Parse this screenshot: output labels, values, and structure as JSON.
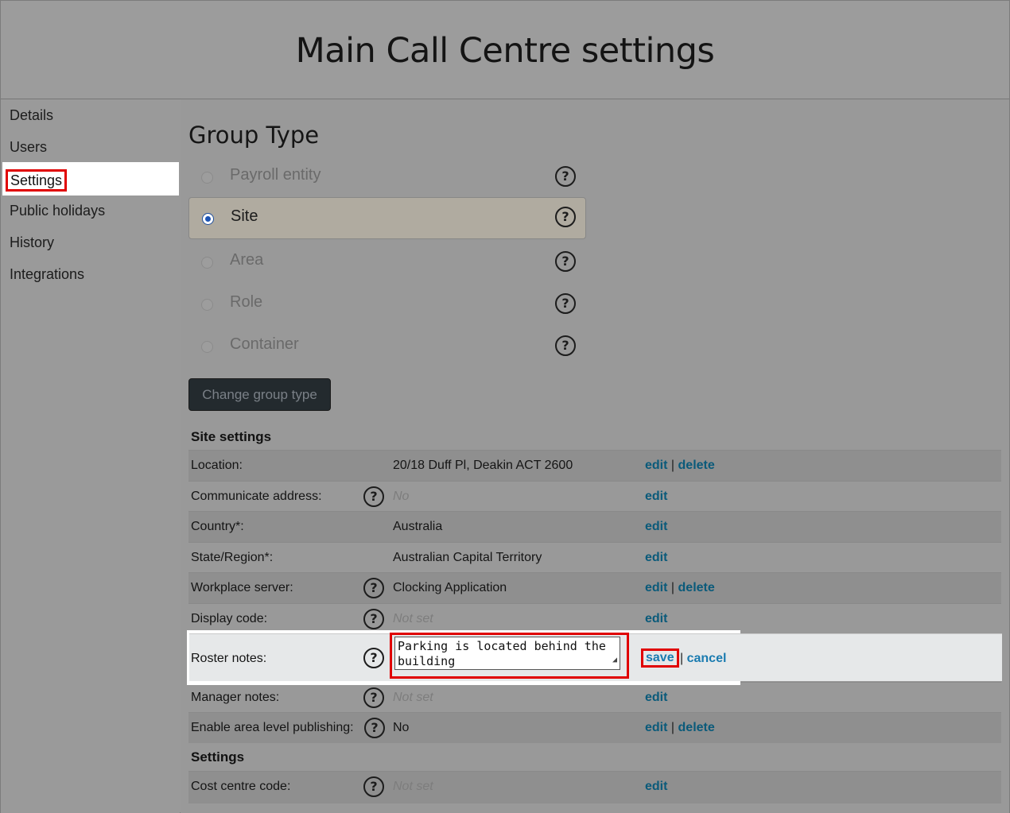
{
  "header": {
    "title": "Main Call Centre settings"
  },
  "sidebar": {
    "items": [
      {
        "label": "Details"
      },
      {
        "label": "Users"
      },
      {
        "label": "Settings"
      },
      {
        "label": "Public holidays"
      },
      {
        "label": "History"
      },
      {
        "label": "Integrations"
      }
    ],
    "active": "Settings"
  },
  "group_type": {
    "title": "Group Type",
    "options": [
      {
        "label": "Payroll entity",
        "selected": false
      },
      {
        "label": "Site",
        "selected": true
      },
      {
        "label": "Area",
        "selected": false
      },
      {
        "label": "Role",
        "selected": false
      },
      {
        "label": "Container",
        "selected": false
      }
    ],
    "change_button": "Change group type"
  },
  "site_settings": {
    "title": "Site settings",
    "rows": [
      {
        "name": "Location:",
        "value": "20/18 Duff Pl, Deakin ACT 2600",
        "edit": "edit",
        "delete": "delete"
      },
      {
        "name": "Communicate address:",
        "value": "No",
        "edit": "edit"
      },
      {
        "name": "Country*:",
        "value": "Australia",
        "edit": "edit"
      },
      {
        "name": "State/Region*:",
        "value": "Australian Capital Territory",
        "edit": "edit"
      },
      {
        "name": "Workplace server:",
        "value": "Clocking Application",
        "edit": "edit",
        "delete": "delete"
      },
      {
        "name": "Display code:",
        "value": "Not set",
        "edit": "edit"
      },
      {
        "name": "Roster notes:",
        "value": "Parking is located behind the building",
        "save": "save",
        "cancel": "cancel"
      },
      {
        "name": "Manager notes:",
        "value": "Not set",
        "edit": "edit"
      },
      {
        "name": "Enable area level publishing:",
        "value": "No",
        "edit": "edit",
        "delete": "delete"
      }
    ],
    "separator": "|"
  },
  "settings": {
    "title": "Settings",
    "rows": [
      {
        "name": "Cost centre code:",
        "value": "Not set",
        "edit": "edit"
      }
    ]
  },
  "help_icon": "?",
  "colors": {
    "highlight": "#e00000",
    "link": "#0a5a7a",
    "active_link": "#1a7bb0"
  }
}
